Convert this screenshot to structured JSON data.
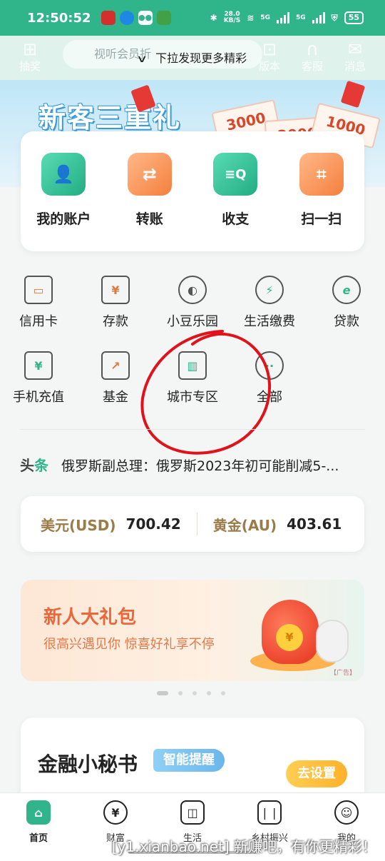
{
  "status_bar": {
    "time": "12:50:52",
    "network_speed": "28.0",
    "network_unit": "KB/S",
    "signal_1": "5G",
    "signal_2": "5G",
    "battery": "55"
  },
  "header": {
    "pull_tip": "下拉发现更多精彩",
    "search_placeholder": "视听会员折",
    "left_icon_label": "抽奖",
    "right_icons": [
      "版本",
      "客服",
      "消息"
    ]
  },
  "banner": {
    "title": "新客三重礼",
    "cash_values": [
      "3000",
      "2000",
      "1000"
    ]
  },
  "quick_actions": [
    {
      "label": "我的账户",
      "icon": "account-icon",
      "glyph": "👤",
      "color": "green"
    },
    {
      "label": "转账",
      "icon": "transfer-icon",
      "glyph": "⇄",
      "color": "orange"
    },
    {
      "label": "收支",
      "icon": "income-expense-icon",
      "glyph": "≡Q",
      "color": "green"
    },
    {
      "label": "扫一扫",
      "icon": "scan-icon",
      "glyph": "⌗",
      "color": "orange"
    }
  ],
  "services": [
    {
      "label": "信用卡",
      "icon": "credit-card-icon",
      "glyph": "▭"
    },
    {
      "label": "存款",
      "icon": "deposit-icon",
      "glyph": "¥"
    },
    {
      "label": "小豆乐园",
      "icon": "bean-park-icon",
      "glyph": "◐"
    },
    {
      "label": "生活缴费",
      "icon": "utility-payment-icon",
      "glyph": "⚡"
    },
    {
      "label": "贷款",
      "icon": "loan-icon",
      "glyph": "e"
    },
    {
      "label": "手机充值",
      "icon": "phone-recharge-icon",
      "glyph": "¥"
    },
    {
      "label": "基金",
      "icon": "fund-icon",
      "glyph": "↗"
    },
    {
      "label": "城市专区",
      "icon": "city-zone-icon",
      "glyph": "▥"
    },
    {
      "label": "全部",
      "icon": "all-services-icon",
      "glyph": "··"
    }
  ],
  "news": {
    "tag_prefix": "头",
    "tag_suffix": "条",
    "headline": "俄罗斯副总理：俄罗斯2023年初可能削减5-..."
  },
  "rates": [
    {
      "label": "美元(USD)",
      "value": "700.42"
    },
    {
      "label": "黄金(AU)",
      "value": "403.61"
    }
  ],
  "promo": {
    "title": "新人大礼包",
    "subtitle": "很高兴遇见你 惊喜好礼享不停",
    "ad_tag": "【广告】",
    "coin_symbol": "¥"
  },
  "secretary": {
    "title": "金融小秘书",
    "badge": "智能提醒",
    "button": "去设置"
  },
  "tabbar": [
    {
      "label": "首页",
      "icon": "home-icon",
      "glyph": "⌂",
      "active": true
    },
    {
      "label": "财富",
      "icon": "wealth-icon",
      "glyph": "¥",
      "active": false
    },
    {
      "label": "生活",
      "icon": "life-bag-icon",
      "glyph": "◫",
      "active": false
    },
    {
      "label": "乡村振兴",
      "icon": "rural-book-icon",
      "glyph": "❘❘",
      "active": false
    },
    {
      "label": "我的",
      "icon": "profile-icon",
      "glyph": "☺",
      "active": false
    }
  ],
  "watermark": "[y1.xianbao.net] 新赚吧，有你更精彩！",
  "colors": {
    "brand_green": "#2fb589",
    "accent_orange": "#f57f3d",
    "annotation_red": "#e0121b"
  }
}
